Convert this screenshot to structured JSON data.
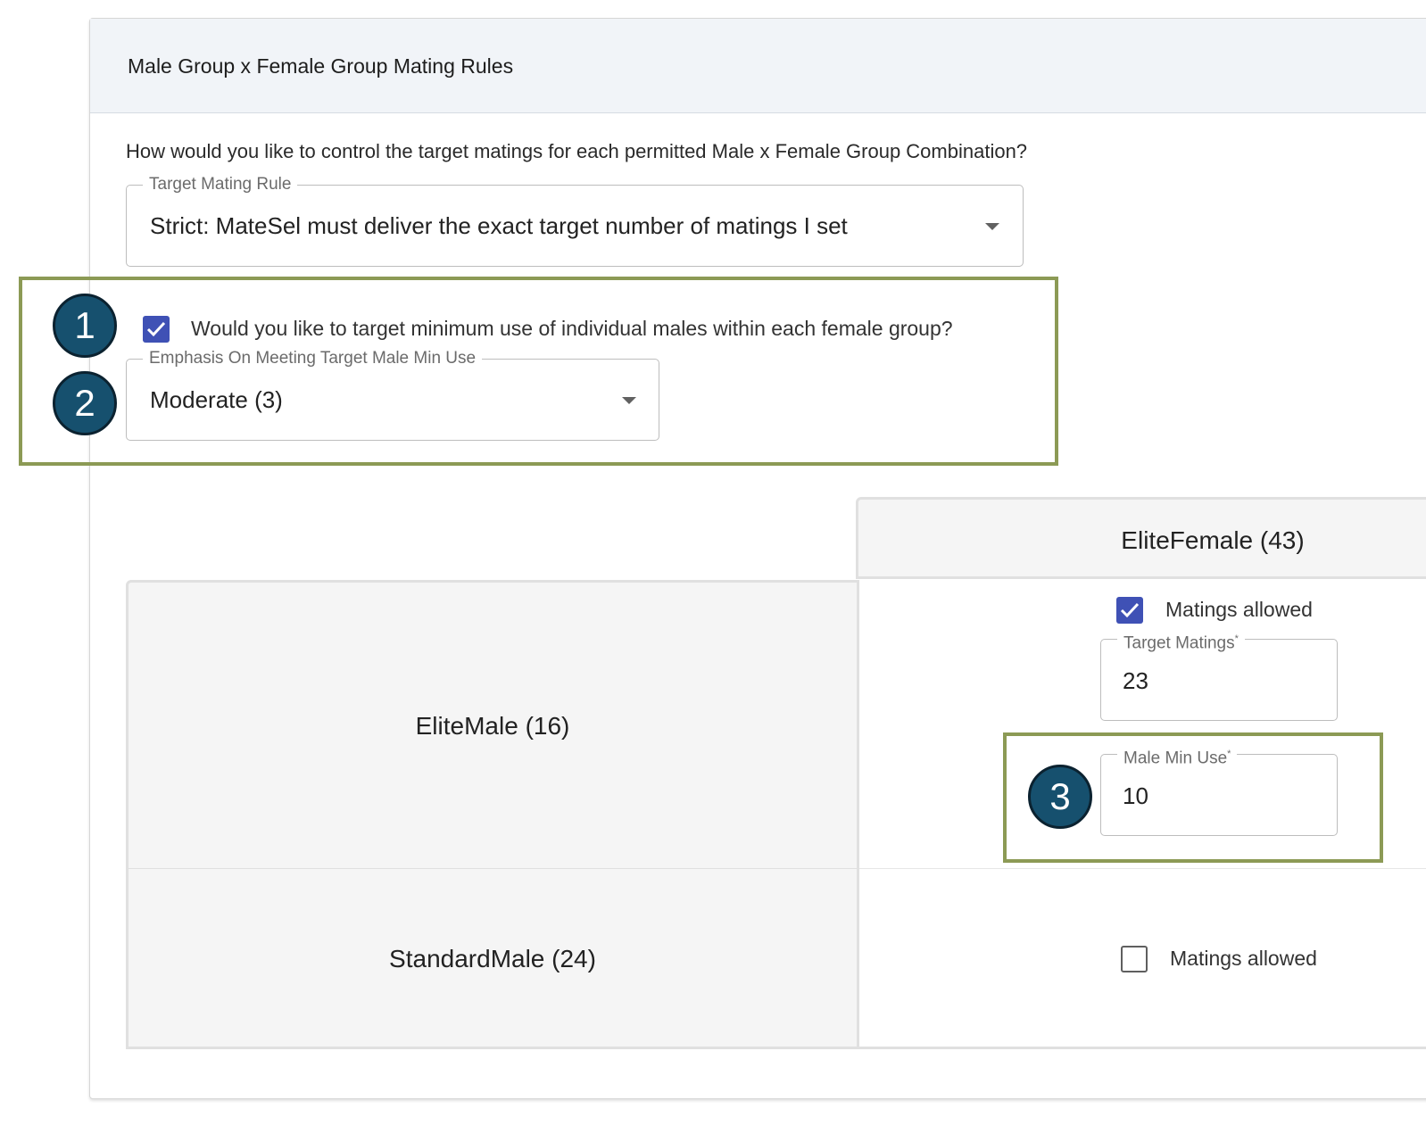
{
  "card": {
    "title": "Male Group x Female Group Mating Rules"
  },
  "question": "How would you like to control the target matings for each permitted Male x Female Group Combination?",
  "target_mating_rule": {
    "label": "Target Mating Rule",
    "value": "Strict: MateSel must deliver the exact target number of matings I set"
  },
  "min_use": {
    "checkbox_label": "Would you like to target minimum use of individual males within each female group?",
    "checked": true,
    "emphasis_label": "Emphasis On Meeting Target Male Min Use",
    "emphasis_value": "Moderate (3)"
  },
  "callouts": [
    "1",
    "2",
    "3"
  ],
  "grid": {
    "column_header": "EliteFemale (43)",
    "rows": [
      {
        "label": "EliteMale (16)",
        "matings_allowed_label": "Matings allowed",
        "matings_allowed": true,
        "target_matings_label": "Target Matings",
        "target_matings_value": "23",
        "male_min_use_label": "Male Min Use",
        "male_min_use_value": "10"
      },
      {
        "label": "StandardMale (24)",
        "matings_allowed_label": "Matings allowed",
        "matings_allowed": false
      }
    ]
  },
  "required_marker": "*",
  "colors": {
    "accent": "#3f51b5",
    "callout_border": "#8c9a55",
    "badge_fill": "#16506e",
    "header_bg": "#f1f4f8"
  },
  "icons": {
    "dropdown": "caret-down-icon",
    "check": "check-icon"
  }
}
